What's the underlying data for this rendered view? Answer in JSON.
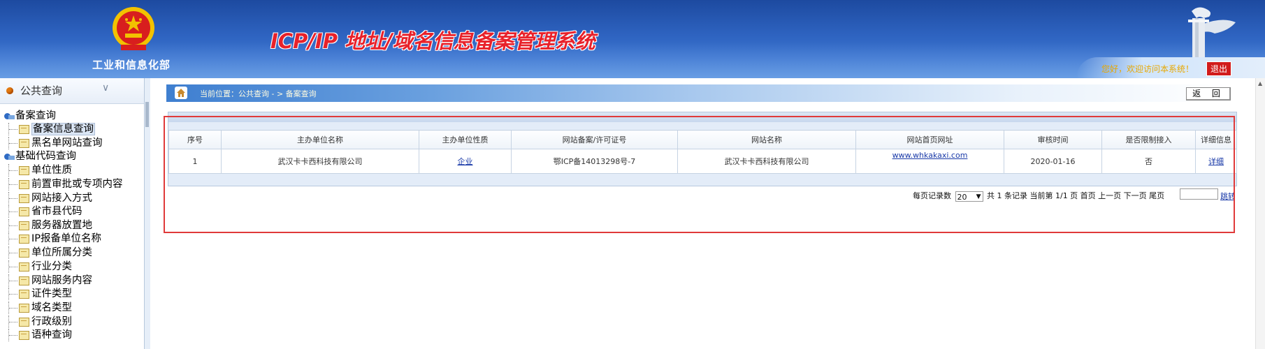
{
  "header": {
    "ministry": "工业和信息化部",
    "system_title": "ICP/IP 地址/域名信息备案管理系统",
    "welcome": "您好，欢迎访问本系统！",
    "logout": "退出"
  },
  "sidebar": {
    "title": "公共查询",
    "items": [
      {
        "type": "group",
        "label": "备案查询"
      },
      {
        "type": "leaf",
        "label": "备案信息查询",
        "active": true
      },
      {
        "type": "leaf",
        "label": "黑名单网站查询"
      },
      {
        "type": "group",
        "label": "基础代码查询"
      },
      {
        "type": "leaf",
        "label": "单位性质"
      },
      {
        "type": "leaf",
        "label": "前置审批或专项内容"
      },
      {
        "type": "leaf",
        "label": "网站接入方式"
      },
      {
        "type": "leaf",
        "label": "省市县代码"
      },
      {
        "type": "leaf",
        "label": "服务器放置地"
      },
      {
        "type": "leaf",
        "label": "IP报备单位名称"
      },
      {
        "type": "leaf",
        "label": "单位所属分类"
      },
      {
        "type": "leaf",
        "label": "行业分类"
      },
      {
        "type": "leaf",
        "label": "网站服务内容"
      },
      {
        "type": "leaf",
        "label": "证件类型"
      },
      {
        "type": "leaf",
        "label": "域名类型"
      },
      {
        "type": "leaf",
        "label": "行政级别"
      },
      {
        "type": "leaf",
        "label": "语种查询"
      }
    ]
  },
  "breadcrumb": "当前位置：公共查询  - >  备案查询",
  "back_button": "返 回",
  "table": {
    "columns": [
      "序号",
      "主办单位名称",
      "主办单位性质",
      "网站备案/许可证号",
      "网站名称",
      "网站首页网址",
      "审核时间",
      "是否限制接入",
      "详细信息"
    ],
    "rows": [
      [
        "1",
        "武汉卡卡西科技有限公司",
        "企业",
        "鄂ICP备14013298号-7",
        "武汉卡卡西科技有限公司",
        "www.whkakaxi.com",
        "2020-01-16",
        "否",
        "详细"
      ]
    ]
  },
  "pager": {
    "per_page_label": "每页记录数",
    "per_page_value": "20",
    "summary": "共 1 条记录  当前第 1/1 页 首页 上一页 下一页 尾页",
    "go": "跳转"
  },
  "colors": {
    "header_blue": "#2e63c0",
    "title_red": "#e8212a",
    "highlight_red": "#e03a3a"
  }
}
